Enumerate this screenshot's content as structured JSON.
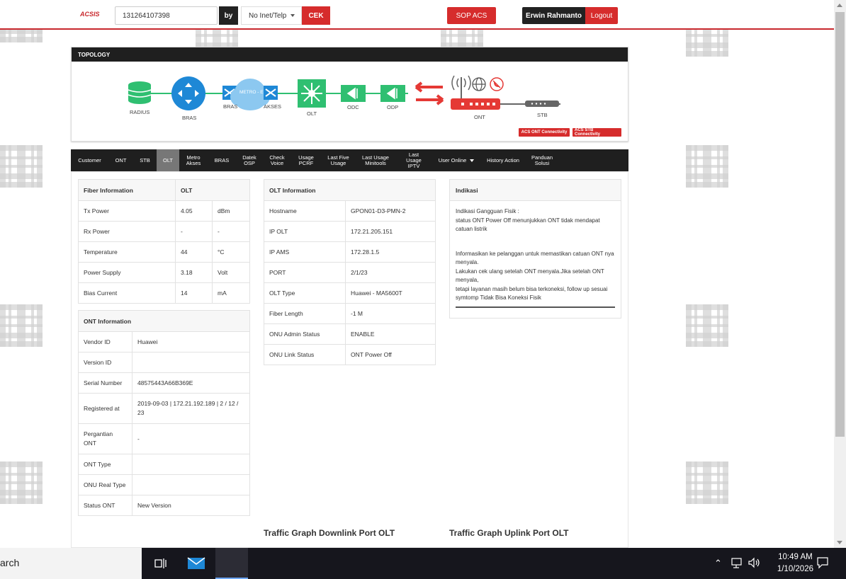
{
  "header": {
    "logo": "ACSIS",
    "search_value": "131264107398",
    "by_label": "by",
    "select_value": "No Inet/Telp",
    "cek_label": "CEK",
    "sop_label": "SOP ACS",
    "user_name": "Erwin Rahmanto",
    "logout_label": "Logout"
  },
  "topology": {
    "title": "TOPOLOGY",
    "nodes": {
      "radius": "RADIUS",
      "bras": "BRAS",
      "bras2": "BRAS",
      "metro": "METRO - E",
      "akses": "AKSES",
      "olt": "OLT",
      "odc": "ODC",
      "odp": "ODP",
      "ont": "ONT",
      "stb": "STB"
    },
    "acs_ont_btn": "ACS ONT Connectivity",
    "acs_stb_btn": "ACS STB Connectivity",
    "colors": {
      "green": "#2fbf71",
      "blue": "#1e88d6",
      "light_blue": "#8cc8f0",
      "red": "#e53935",
      "gray": "#666666"
    }
  },
  "tabs": [
    {
      "label": "Customer"
    },
    {
      "label": "ONT"
    },
    {
      "label": "STB"
    },
    {
      "label": "OLT",
      "active": true
    },
    {
      "label": "Metro Akses"
    },
    {
      "label": "BRAS"
    },
    {
      "label": "Datek OSP"
    },
    {
      "label": "Check Voice"
    },
    {
      "label": "Usage PCRF"
    },
    {
      "label": "Last Five Usage"
    },
    {
      "label": "Last Usage Minitools"
    },
    {
      "label": "Last Usage IPTV"
    },
    {
      "label": "User Online"
    },
    {
      "label": "History Action"
    },
    {
      "label": "Panduan Solusi"
    }
  ],
  "fiber": {
    "header": [
      "Fiber Information",
      "OLT"
    ],
    "rows": [
      [
        "Tx Power",
        "4.05",
        "dBm"
      ],
      [
        "Rx Power",
        "-",
        "-"
      ],
      [
        "Temperature",
        "44",
        "°C"
      ],
      [
        "Power Supply",
        "3.18",
        "Volt"
      ],
      [
        "Bias Current",
        "14",
        "mA"
      ]
    ]
  },
  "ont_info": {
    "header": "ONT Information",
    "rows": [
      [
        "Vendor ID",
        "Huawei"
      ],
      [
        "Version ID",
        ""
      ],
      [
        "Serial Number",
        "48575443A66B369E"
      ],
      [
        "Registered at",
        "2019-09-03 | 172.21.192.189 | 2 / 12 / 23"
      ],
      [
        "Pergantian ONT",
        "-"
      ],
      [
        "ONT Type",
        ""
      ],
      [
        "ONU Real Type",
        ""
      ],
      [
        "Status ONT",
        "New Version"
      ]
    ]
  },
  "olt_info": {
    "header": "OLT Information",
    "rows": [
      [
        "Hostname",
        "GPON01-D3-PMN-2"
      ],
      [
        "IP OLT",
        "172.21.205.151"
      ],
      [
        "IP AMS",
        "172.28.1.5"
      ],
      [
        "PORT",
        "2/1/23"
      ],
      [
        "OLT Type",
        "Huawei - MA5600T"
      ],
      [
        "Fiber Length",
        "-1 M"
      ],
      [
        "ONU Admin Status",
        "ENABLE"
      ],
      [
        "ONU Link Status",
        "ONT Power Off"
      ]
    ]
  },
  "indikasi": {
    "header": "Indikasi",
    "line1": "Indikasi Gangguan Fisik :",
    "line2": "status ONT Power Off menunjukkan ONT tidak mendapat catuan listrik",
    "line3": "Informasikan ke pelanggan untuk memastikan catuan ONT nya menyala.",
    "line4": "Lakukan cek ulang setelah ONT menyala.Jika setelah ONT menyala,",
    "line5": "tetapi layanan masih belum bisa terkoneksi, follow up sesuai symtomp Tidak Bisa Koneksi Fisik"
  },
  "graphs": {
    "downlink": "Traffic Graph Downlink Port OLT",
    "uplink": "Traffic Graph Uplink Port OLT"
  },
  "taskbar": {
    "search_text": "arch",
    "time": "10:49 AM",
    "date": "1/10/2026"
  }
}
